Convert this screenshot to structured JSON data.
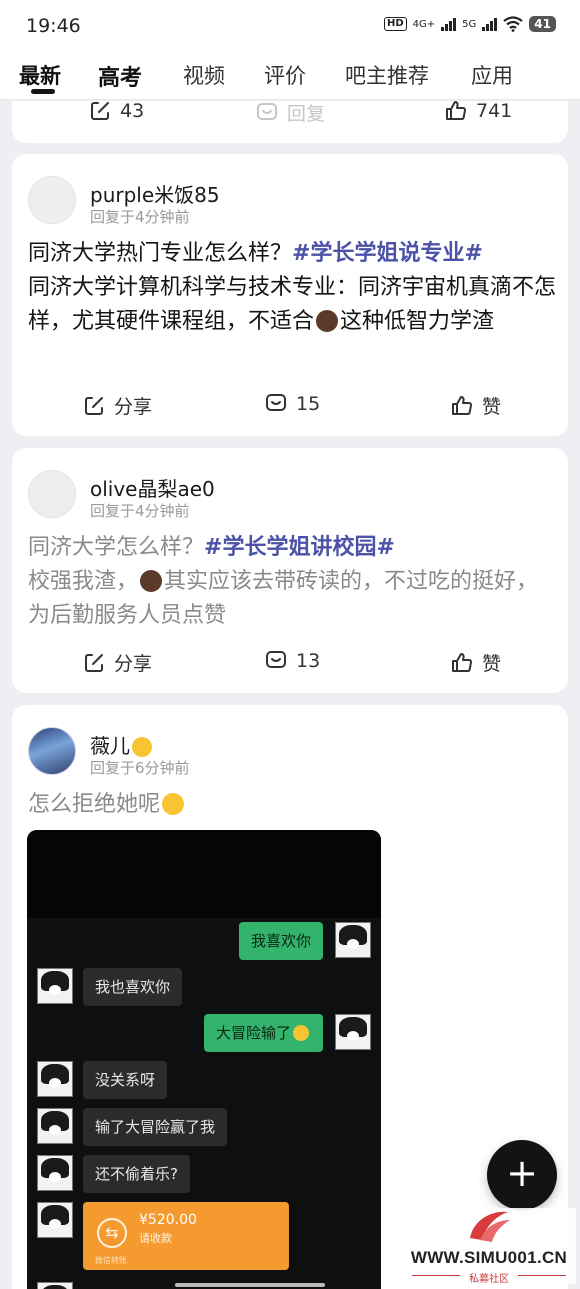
{
  "status_bar": {
    "time": "19:46",
    "hd_badge": "HD",
    "net_4g": "4G+",
    "net_5g": "5G",
    "battery": "41"
  },
  "tabs": [
    {
      "label": "最新",
      "active": true
    },
    {
      "label": "高考"
    },
    {
      "label": "视频"
    },
    {
      "label": "评价"
    },
    {
      "label": "吧主推荐"
    },
    {
      "label": "应用"
    }
  ],
  "prev_card": {
    "share_count": "43",
    "reply_label": "回复",
    "like_count": "741"
  },
  "posts": [
    {
      "username": "purple米饭85",
      "meta": "回复于4分钟前",
      "title": "同济大学热门专业怎么样？",
      "topic": "#学长学姐说专业#",
      "body_before_emoji": "同济大学计算机科学与技术专业：同济宇宙机真滴不怎样，尤其硬件课程组，不适合",
      "body_after_emoji": "这种低智力学渣",
      "share_label": "分享",
      "comment_count": "15",
      "like_label": "赞"
    },
    {
      "username": "olive晶梨ae0",
      "meta": "回复于4分钟前",
      "title": "同济大学怎么样？",
      "topic": "#学长学姐讲校园#",
      "body_before_emoji": "校强我渣，",
      "body_after_emoji": "其实应该去带砖读的，不过吃的挺好，为后勤服务人员点赞",
      "share_label": "分享",
      "comment_count": "13",
      "like_label": "赞"
    },
    {
      "username": "薇儿",
      "meta": "回复于6分钟前",
      "text": "怎么拒绝她呢"
    }
  ],
  "chat_image": {
    "messages": [
      {
        "side": "right",
        "text": "我喜欢你"
      },
      {
        "side": "left",
        "text": "我也喜欢你"
      },
      {
        "side": "right",
        "text": "大冒险输了"
      },
      {
        "side": "left",
        "text": "没关系呀"
      },
      {
        "side": "left",
        "text": "输了大冒险赢了我"
      },
      {
        "side": "left",
        "text": "还不偷着乐?"
      }
    ],
    "red_packet": {
      "amount": "¥520.00",
      "subtitle": "请收款",
      "footer": "微信转账"
    }
  },
  "fab": {
    "label": "+"
  },
  "watermark": {
    "text": "WWW.SIMU001.CN",
    "subtitle": "私募社区"
  },
  "icons": [
    "share-icon",
    "comment-icon",
    "like-icon",
    "plus-icon",
    "wifi-icon",
    "signal-icon"
  ],
  "colors": {
    "topic": "#4b52a8",
    "fab": "#131313",
    "wechat_green": "#33b36b",
    "red_packet": "#f49a2f"
  }
}
